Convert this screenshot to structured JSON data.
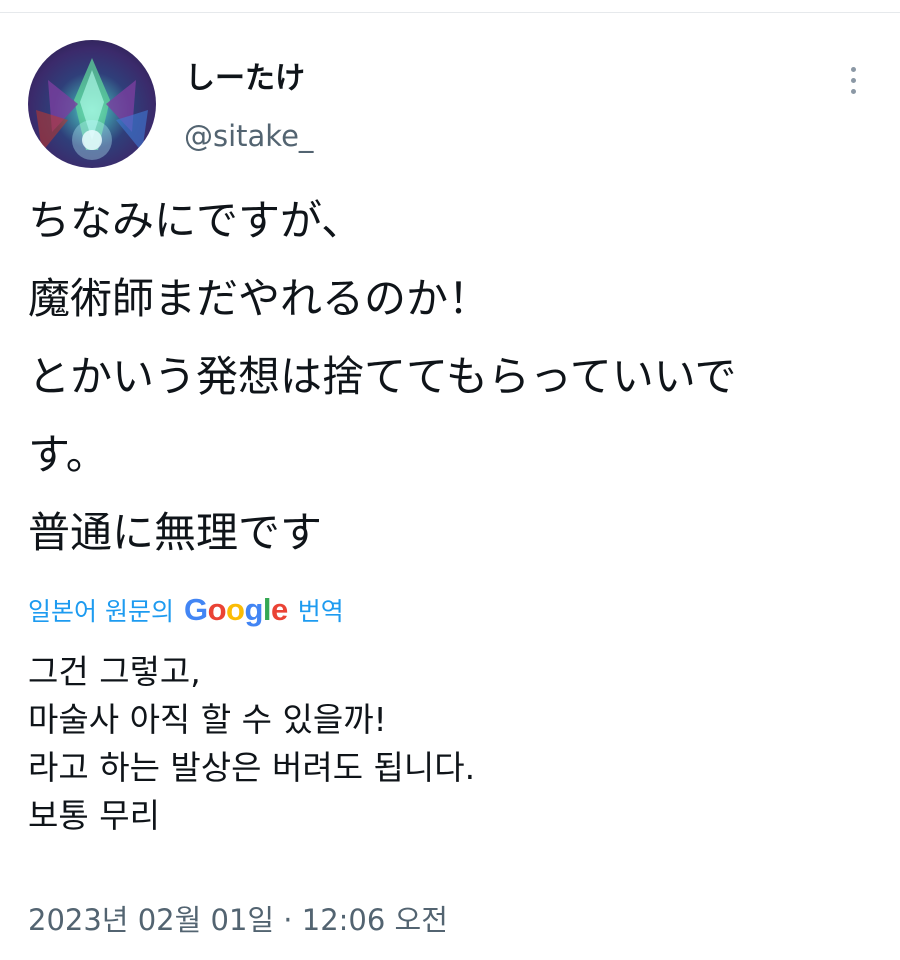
{
  "author": {
    "display_name": "しーたけ",
    "handle": "@sitake_",
    "avatar_icon": "user-avatar-icon"
  },
  "more_icon": "more-vertical-icon",
  "tweet": {
    "lines": [
      "ちなみにですが、",
      "魔術師まだやれるのか！",
      "とかいう発想は捨ててもらっていいで",
      "す。",
      "普通に無理です"
    ]
  },
  "translate": {
    "prefix": "일본어 원문의",
    "brand_letters": [
      "G",
      "o",
      "o",
      "g",
      "l",
      "e"
    ],
    "suffix": "번역",
    "link_color": "#1d9bf0"
  },
  "translation": {
    "lines": [
      "그건 그렇고,",
      "마술사 아직 할 수 있을까!",
      "라고 하는 발상은 버려도 됩니다.",
      "보통 무리"
    ]
  },
  "timestamp": "2023년 02월 01일 · 12:06 오전"
}
